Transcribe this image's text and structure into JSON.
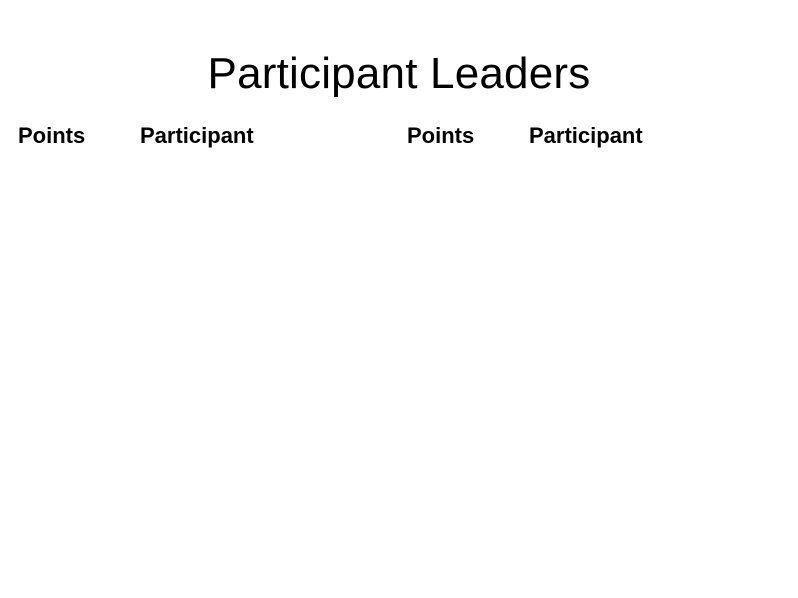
{
  "title": "Participant Leaders",
  "tables": [
    {
      "headers": {
        "points": "Points",
        "participant": "Participant"
      },
      "rows": []
    },
    {
      "headers": {
        "points": "Points",
        "participant": "Participant"
      },
      "rows": []
    }
  ]
}
